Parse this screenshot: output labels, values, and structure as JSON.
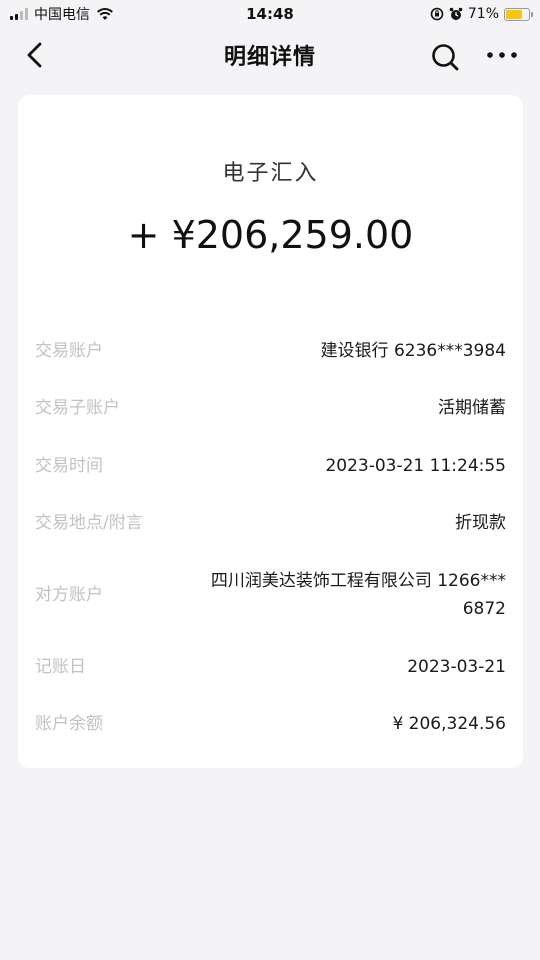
{
  "status_bar": {
    "carrier": "中国电信",
    "time": "14:48",
    "battery": "71%",
    "battery_level": 0.71,
    "battery_color": "#f5c518"
  },
  "nav": {
    "title": "明细详情",
    "back_icon": "chevron-left-icon",
    "search_icon": "search-icon",
    "more_icon": "more-horizontal-icon"
  },
  "transaction": {
    "type": "电子汇入",
    "amount": "+ ¥206,259.00",
    "details": [
      {
        "label": "交易账户",
        "value": "建设银行 6236***3984"
      },
      {
        "label": "交易子账户",
        "value": "活期储蓄"
      },
      {
        "label": "交易时间",
        "value": "2023-03-21 11:24:55"
      },
      {
        "label": "交易地点/附言",
        "value": "折现款"
      },
      {
        "label": "对方账户",
        "value": "四川润美达装饰工程有限公司 1266***6872"
      },
      {
        "label": "记账日",
        "value": "2023-03-21"
      },
      {
        "label": "账户余额",
        "value": "¥ 206,324.56"
      }
    ]
  }
}
